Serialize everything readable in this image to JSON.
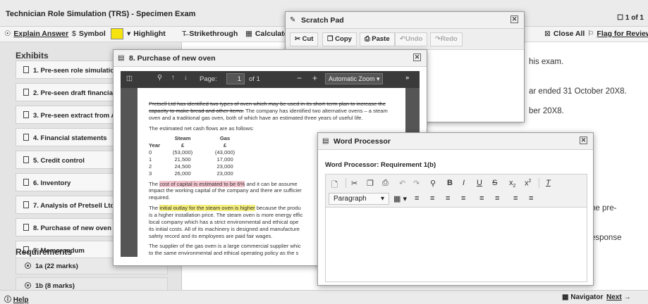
{
  "app": {
    "title": "Technician Role Simulation (TRS) - Specimen Exam",
    "page_indicator": "1 of 1"
  },
  "toolbar": {
    "explain_answer": "Explain Answer",
    "symbol": "Symbol",
    "highlight": "Highlight",
    "strikethrough": "Strikethrough",
    "calculator": "Calculator",
    "close_all": "Close All",
    "flag_for_review": "Flag for Review",
    "highlight_color": "#f5e30f"
  },
  "exhibits": {
    "heading": "Exhibits",
    "items": [
      "1. Pre-seen role simulation",
      "2. Pre-seen draft financial",
      "3. Pre-seen extract from A",
      "4. Financial statements",
      "5. Credit control",
      "6. Inventory",
      "7. Analysis of Pretsell Ltd",
      "8. Purchase of new oven",
      "9. Memorandum"
    ]
  },
  "requirements": {
    "heading": "Requirements",
    "items": [
      "1a (22 marks)",
      "1b (8 marks)"
    ]
  },
  "main": {
    "line1": "his exam.",
    "line2": "ar ended 31 October 20X8.",
    "line3": "ber 20X8.",
    "line4": "he pre-",
    "line5": "esponse"
  },
  "status": {
    "help": "Help",
    "navigator": "Navigator",
    "next": "Next"
  },
  "scratch_pad": {
    "title": "Scratch Pad",
    "buttons": [
      "Cut",
      "Copy",
      "Paste",
      "Undo",
      "Redo"
    ]
  },
  "purchase_window": {
    "title": "8. Purchase of new oven",
    "viewer": {
      "page_label": "Page:",
      "page_value": "1",
      "page_of": "of 1",
      "zoom": "Automatic Zoom"
    },
    "para1": "Pretsell Ltd has identified two types of oven which may be used in its short-term plan to increase the capacity to make bread and other items. The company has identified two alternative ovens – a steam oven and a traditional gas oven, both of which have an estimated three years of useful life.",
    "para1_struck": "Pretsell Ltd has identified two types of oven which may be used in its short-term plan to increase the capacity to make bread and other items.",
    "para1_rest": " The company has identified two alternative ovens – a steam oven and a traditional gas oven, both of which have an estimated three years of useful life.",
    "ncf_intro": "The estimated net cash flows are as follows:",
    "table": {
      "headers": [
        "",
        "Steam",
        "Gas"
      ],
      "units": [
        "Year",
        "£",
        "£"
      ],
      "rows": [
        [
          "0",
          "(53,000)",
          "(43,000)"
        ],
        [
          "1",
          "21,500",
          "17,000"
        ],
        [
          "2",
          "24,500",
          "23,000"
        ],
        [
          "3",
          "26,000",
          "23,000"
        ]
      ]
    },
    "para2_hl": "cost of capital is estimated to be 6%",
    "para2_pre": "The ",
    "para2_post": " and it can be assume",
    "para2_line2": "impact the working capital of the company and there are sufficier",
    "para2_line3": "required.",
    "para3_pre": "The ",
    "para3_hl": "initial outlay for the steam oven is higher",
    "para3_post": " because the produ",
    "para3_line2": "is a higher installation price. The steam oven is more energy effic",
    "para3_line3": "local company which has a strict environmental and ethical ope",
    "para3_line4": "its initial costs. All of its machinery is designed and manufacture",
    "para3_line5": "safety record and its employees are paid fair wages.",
    "para4_line1": "The supplier of the gas oven is a large commercial supplier whic",
    "para4_line2": "to the same environmental and ethical operating policy as the s"
  },
  "word_processor": {
    "title": "Word Processor",
    "label": "Word Processor: Requirement 1(b)",
    "paragraph_select": "Paragraph"
  }
}
